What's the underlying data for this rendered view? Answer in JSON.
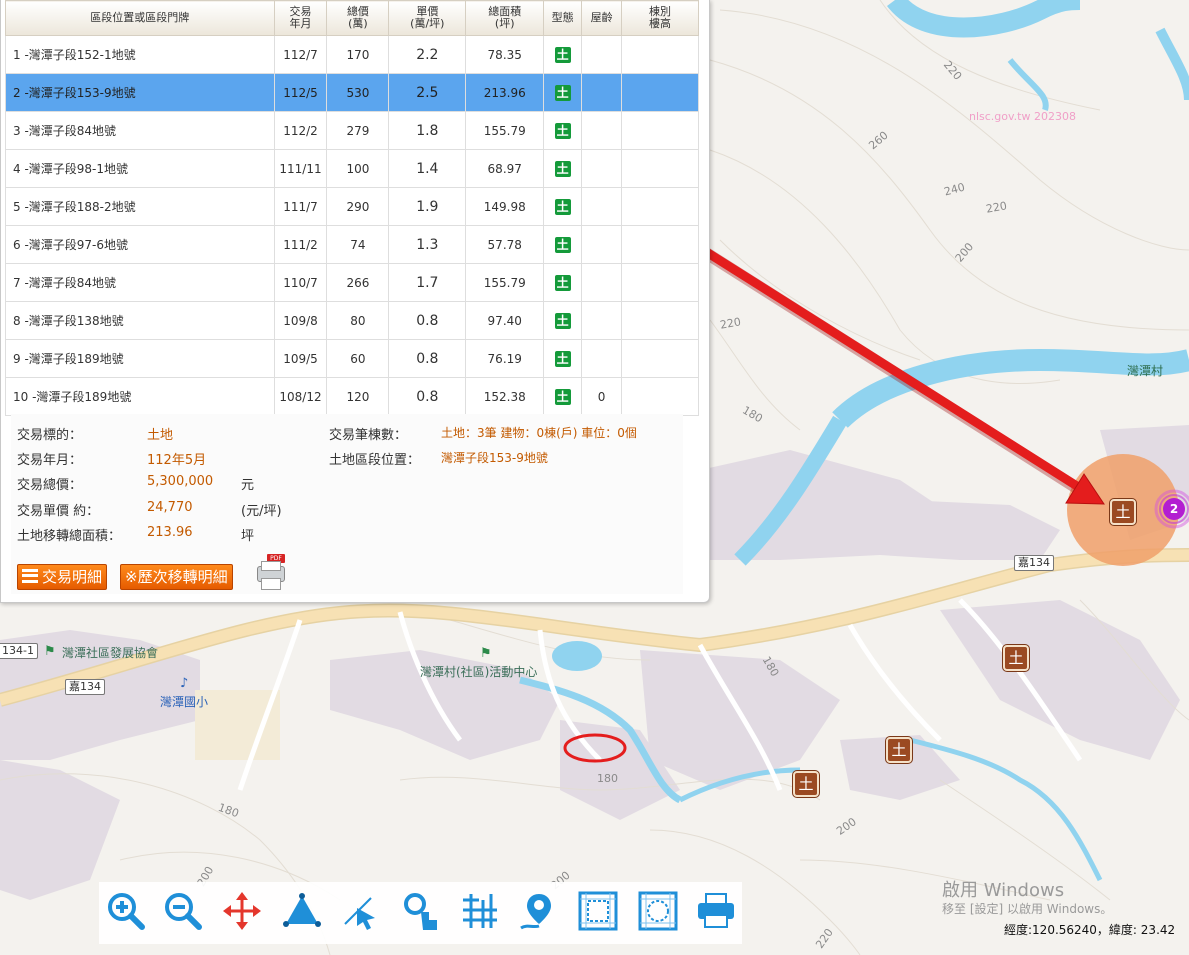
{
  "table": {
    "headers": {
      "address": "區段位置或區段門牌",
      "date_1": "交易",
      "date_2": "年月",
      "total_1": "總價",
      "total_2": "(萬)",
      "unit_1": "單價",
      "unit_2": "(萬/坪)",
      "area_1": "總面積",
      "area_2": "(坪)",
      "type": "型態",
      "age": "屋齡",
      "floor_1": "棟別",
      "floor_2": "樓高"
    },
    "rows": [
      {
        "address": "1 -灣潭子段152-1地號",
        "date": "112/7",
        "total": "170",
        "unit": "2.2",
        "area": "78.35",
        "type": "土",
        "age": ""
      },
      {
        "address": "2 -灣潭子段153-9地號",
        "date": "112/5",
        "total": "530",
        "unit": "2.5",
        "area": "213.96",
        "type": "土",
        "age": ""
      },
      {
        "address": "3 -灣潭子段84地號",
        "date": "112/2",
        "total": "279",
        "unit": "1.8",
        "area": "155.79",
        "type": "土",
        "age": ""
      },
      {
        "address": "4 -灣潭子段98-1地號",
        "date": "111/11",
        "total": "100",
        "unit": "1.4",
        "area": "68.97",
        "type": "土",
        "age": ""
      },
      {
        "address": "5 -灣潭子段188-2地號",
        "date": "111/7",
        "total": "290",
        "unit": "1.9",
        "area": "149.98",
        "type": "土",
        "age": ""
      },
      {
        "address": "6 -灣潭子段97-6地號",
        "date": "111/2",
        "total": "74",
        "unit": "1.3",
        "area": "57.78",
        "type": "土",
        "age": ""
      },
      {
        "address": "7 -灣潭子段84地號",
        "date": "110/7",
        "total": "266",
        "unit": "1.7",
        "area": "155.79",
        "type": "土",
        "age": ""
      },
      {
        "address": "8 -灣潭子段138地號",
        "date": "109/8",
        "total": "80",
        "unit": "0.8",
        "area": "97.40",
        "type": "土",
        "age": ""
      },
      {
        "address": "9 -灣潭子段189地號",
        "date": "109/5",
        "total": "60",
        "unit": "0.8",
        "area": "76.19",
        "type": "土",
        "age": ""
      },
      {
        "address": "10 -灣潭子段189地號",
        "date": "108/12",
        "total": "120",
        "unit": "0.8",
        "area": "152.38",
        "type": "土",
        "age": "0"
      }
    ],
    "selected_index": 1
  },
  "details": {
    "target_label": "交易標的：",
    "target_value": "土地",
    "date_label": "交易年月：",
    "date_value": "112年5月",
    "total_label": "交易總價：",
    "total_value": "5,300,000",
    "total_unit": "元",
    "unit_label": "交易單價 約：",
    "unit_value": "24,770",
    "unit_unit": "(元/坪)",
    "area_label": "土地移轉總面積：",
    "area_value": "213.96",
    "area_unit": "坪",
    "count_label": "交易筆棟數：",
    "count_value": "土地：3筆 建物：0棟(戶) 車位：0個",
    "location_label": "土地區段位置：",
    "location_value": "灣潭子段153-9地號",
    "btn_detail": "交易明細",
    "btn_history": "※歷次移轉明細",
    "pdf_label": "PDF"
  },
  "map": {
    "watermark": "nlsc.gov.tw 202308",
    "village_label": "灣潭村",
    "community_center": "灣潭村(社區)活動中心",
    "association": "灣潭社區發展協會",
    "school": "灣潭國小",
    "road_1": "嘉134",
    "road_2": "嘉134",
    "road_3": "134-1",
    "contours": [
      "220",
      "260",
      "240",
      "220",
      "200",
      "220",
      "180",
      "180",
      "180",
      "180",
      "200",
      "200",
      "200",
      "220"
    ],
    "cluster_count": "2",
    "land_glyph": "土"
  },
  "status": {
    "activate_title": "啟用 Windows",
    "activate_sub": "移至 [設定] 以啟用 Windows。",
    "coords": "經度:120.56240，緯度: 23.42"
  },
  "colors": {
    "selected_row": "#5ba5ee",
    "land_green": "#149a3a",
    "river": "#90d3ef",
    "road": "#f7e1b4",
    "arrow": "#e41d1d",
    "cluster": "#f0a06a",
    "button": "#ef6c0c"
  },
  "toolbar": {
    "icons": [
      "zoom-in-icon",
      "zoom-out-icon",
      "pan-icon",
      "measure-area-icon",
      "select-arrow-icon",
      "identify-icon",
      "grid-icon",
      "locate-pin-icon",
      "frame-icon",
      "frame-dashed-icon",
      "print-icon"
    ]
  }
}
